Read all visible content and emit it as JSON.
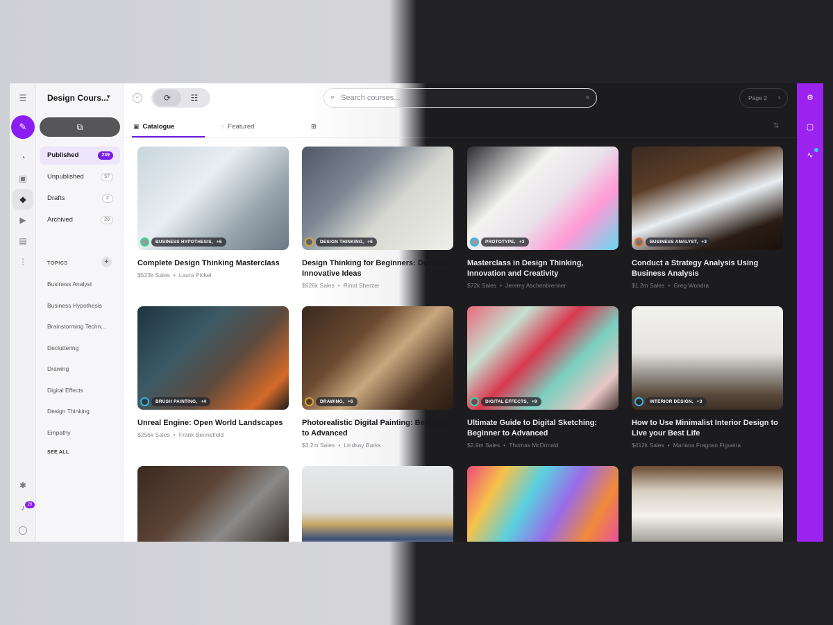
{
  "sidebar": {
    "project_title": "Design Cours...",
    "statuses": [
      {
        "label": "Published",
        "count": "239"
      },
      {
        "label": "Unpublished",
        "count": "57"
      },
      {
        "label": "Drafts",
        "count": "2"
      },
      {
        "label": "Archived",
        "count": "28"
      }
    ],
    "topics_heading": "TOPICS",
    "topics": [
      "Business Analyst",
      "Business Hypothesis",
      "Brainstorming Techn...",
      "Decluttering",
      "Drawing",
      "Digital Effects",
      "Design Thinking",
      "Empathy"
    ],
    "see_all": "SEE ALL"
  },
  "rail": {
    "notification_count": "26"
  },
  "toolbar": {
    "search_placeholder": "Search courses...",
    "page_label": "Page 2"
  },
  "tabs": [
    {
      "label": "Catalogue",
      "active": true
    },
    {
      "label": "Featured",
      "active": false
    },
    {
      "label": "",
      "active": false
    }
  ],
  "courses": [
    {
      "title": "Complete Design Thinking Masterclass",
      "tag": "BUSINESS HYPOTHESIS,",
      "more": "+6",
      "sales": "$523k Sales",
      "author": "Laura Pickel",
      "ring": "#2dd88f"
    },
    {
      "title": "Design Thinking for Beginners: Develop Innovative Ideas",
      "tag": "DESIGN THINKING,",
      "more": "+6",
      "sales": "$926k Sales",
      "author": "Rinat Sherzer",
      "ring": "#d9a531"
    },
    {
      "title": "Masterclass in Design Thinking, Innovation and Creativity",
      "tag": "PROTOTYPE,",
      "more": "+3",
      "sales": "$72k Sales",
      "author": "Jeremy Aschenbrenner",
      "ring": "#2fb6ea"
    },
    {
      "title": "Conduct a Strategy Analysis Using Business Analysis",
      "tag": "BUSINESS ANALYST,",
      "more": "+3",
      "sales": "$1.2m Sales",
      "author": "Greg Wondra",
      "ring": "#f06a2b"
    },
    {
      "title": "Unreal Engine: Open World Landscapes",
      "tag": "BRUSH PAINTING,",
      "more": "+4",
      "sales": "$256k Sales",
      "author": "Frank Bennefield",
      "ring": "#2fb6ea"
    },
    {
      "title": "Photorealistic Digital Painting: Beginner to Advanced",
      "tag": "DRAWING,",
      "more": "+6",
      "sales": "$3.2m Sales",
      "author": "Lindsay Barks",
      "ring": "#d9a531"
    },
    {
      "title": "Ultimate Guide to Digital Sketching: Beginner to Advanced",
      "tag": "DIGITAL EFFECTS,",
      "more": "+9",
      "sales": "$2.9m Sales",
      "author": "Thomas McDonald",
      "ring": "#2dd8b5"
    },
    {
      "title": "How to Use Minimalist Interior Design to Live your Best Life",
      "tag": "INTERIOR DESIGN,",
      "more": "+3",
      "sales": "$412k Sales",
      "author": "Mariana Fragoso Figueira",
      "ring": "#2fb6ea"
    }
  ],
  "colors": {
    "accent": "#8a1df0",
    "right_bar": "#9b22ef",
    "active_tab": "#6c1ce0"
  }
}
